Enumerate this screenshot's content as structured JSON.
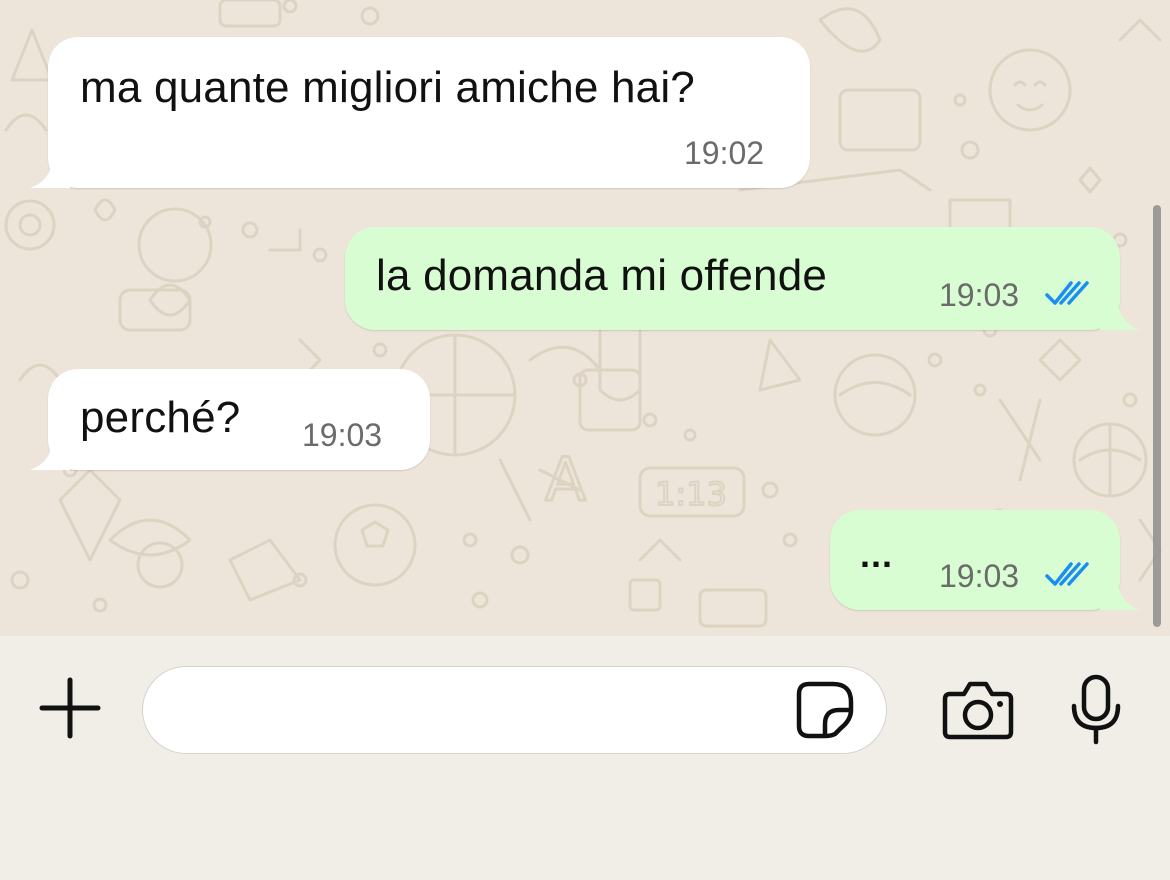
{
  "chat": {
    "messages": [
      {
        "direction": "incoming",
        "text": "ma quante migliori amiche hai?",
        "time": "19:02"
      },
      {
        "direction": "outgoing",
        "text": "la domanda mi offende",
        "time": "19:03",
        "status": "read"
      },
      {
        "direction": "incoming",
        "text": "perché?",
        "time": "19:03"
      },
      {
        "direction": "outgoing",
        "text": "...",
        "time": "19:03",
        "status": "read"
      }
    ]
  },
  "composer": {
    "input_value": "",
    "input_placeholder": "",
    "buttons": [
      "plus-icon",
      "sticker-icon",
      "camera-icon",
      "microphone-icon"
    ]
  },
  "colors": {
    "wallpaper": "#ede5d9",
    "incoming_bubble": "#ffffff",
    "outgoing_bubble": "#d9fdd3",
    "read_ticks": "#1b8ef2",
    "composer_bg": "#f1ede7"
  }
}
